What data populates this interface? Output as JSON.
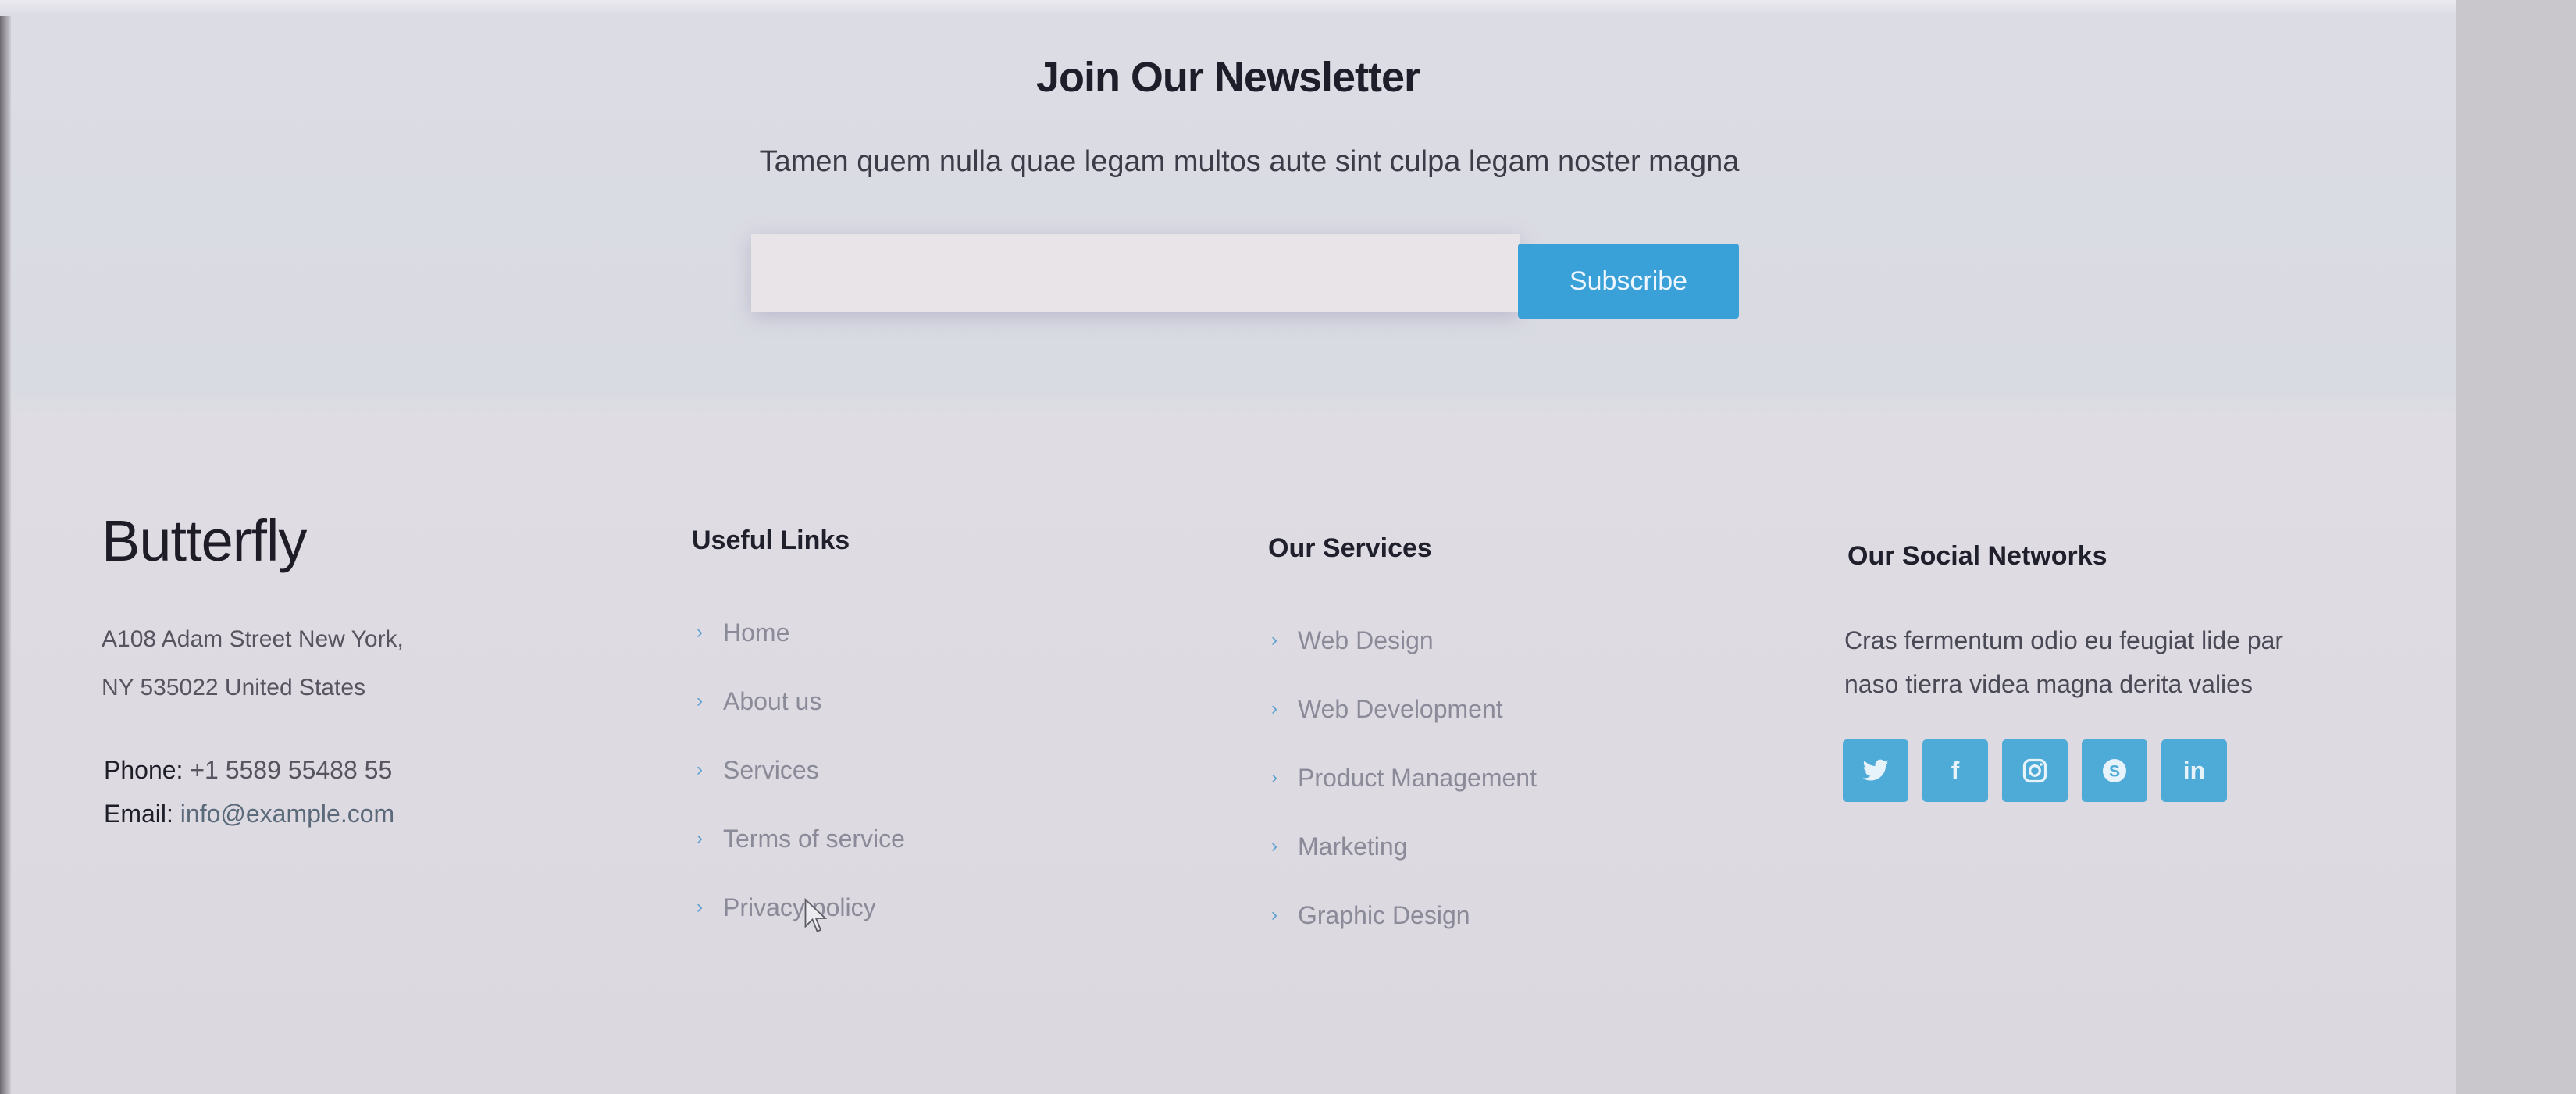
{
  "newsletter": {
    "title": "Join Our Newsletter",
    "description": "Tamen quem nulla quae legam multos aute sint culpa legam noster magna",
    "email_placeholder": "",
    "subscribe_label": "Subscribe"
  },
  "footer": {
    "brand": "Butterfly",
    "address_line1": "A108 Adam Street New York,",
    "address_line2": "NY 535022 United States",
    "phone_label": "Phone:",
    "phone_value": "+1 5589 55488 55",
    "email_label": "Email:",
    "email_value": "info@example.com",
    "useful_links": {
      "title": "Useful Links",
      "items": [
        "Home",
        "About us",
        "Services",
        "Terms of service",
        "Privacy policy"
      ]
    },
    "services": {
      "title": "Our Services",
      "items": [
        "Web Design",
        "Web Development",
        "Product Management",
        "Marketing",
        "Graphic Design"
      ]
    },
    "social": {
      "title": "Our Social Networks",
      "description": "Cras fermentum odio eu feugiat lide par naso tierra videa magna derita valies",
      "icons": [
        "twitter-icon",
        "facebook-icon",
        "instagram-icon",
        "skype-icon",
        "linkedin-icon"
      ]
    }
  },
  "colors": {
    "accent": "#3aa0d8",
    "social_button": "#4eaad6",
    "link_text": "#8a8a98"
  }
}
